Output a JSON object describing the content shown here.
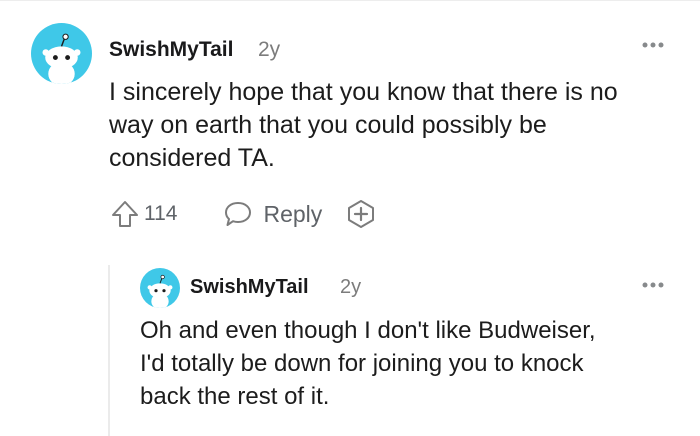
{
  "comments": [
    {
      "username": "SwishMyTail",
      "age": "2y",
      "text": "I sincerely hope that you know that there is no way on earth that you could possibly be considered TA.",
      "lines": [
        "I sincerely hope that you know that there is no",
        "way on earth that you could possibly be",
        "considered TA."
      ],
      "upvotes": "114",
      "reply_label": "Reply",
      "avatar_color": "#3fc8e8"
    },
    {
      "username": "SwishMyTail",
      "age": "2y",
      "text": "Oh and even though I don't like Budweiser, I'd totally be down for joining you to knock back the rest of it.",
      "lines": [
        "Oh and even though I don't like Budweiser,",
        "I'd totally be down for joining you to knock",
        "back the rest of it."
      ],
      "avatar_color": "#3fc8e8"
    }
  ],
  "icons": {
    "more": "more-options-icon",
    "upvote": "upvote-arrow-icon",
    "reply": "comment-bubble-icon",
    "award": "add-award-icon"
  }
}
